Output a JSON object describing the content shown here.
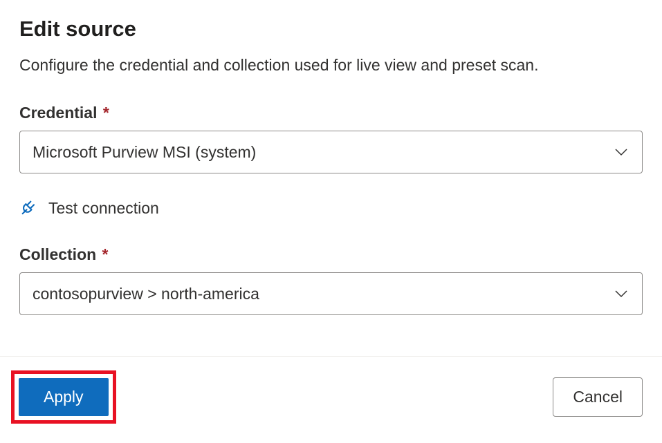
{
  "header": {
    "title": "Edit source",
    "description": "Configure the credential and collection used for live view and preset scan."
  },
  "fields": {
    "credential": {
      "label": "Credential",
      "value": "Microsoft Purview MSI (system)"
    },
    "collection": {
      "label": "Collection",
      "value": "contosopurview > north-america"
    }
  },
  "actions": {
    "test_connection": "Test connection",
    "apply": "Apply",
    "cancel": "Cancel"
  },
  "colors": {
    "primary": "#0f6cbd",
    "required": "#a4262c",
    "highlight_border": "#e81123",
    "icon_accent": "#0f6cbd"
  }
}
